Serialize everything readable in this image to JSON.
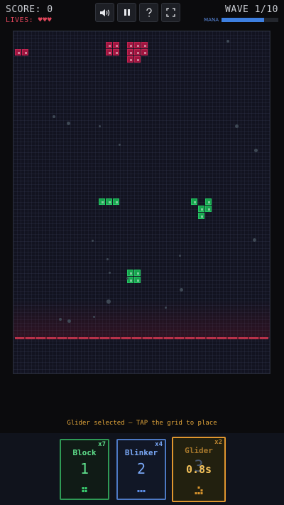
{
  "hud": {
    "score": "SCORE: 0",
    "lives": "LIVES: ♥♥♥",
    "wave": "WAVE 1/10",
    "mana_label": "MANA",
    "mana_fraction": 0.75
  },
  "toolbar": {
    "sound_icon": "speaker-icon",
    "pause_icon": "pause-icon",
    "help_icon": "question-icon",
    "fullscreen_icon": "fullscreen-icon"
  },
  "board": {
    "enemy_color": "#a0143f",
    "ally_color": "#16a34d",
    "defense_line_color": "#b8324a"
  },
  "hint": "Glider selected — TAP the grid to place",
  "cards": [
    {
      "name": "Block",
      "count": "x7",
      "cost": "1",
      "color": "#3ad371"
    },
    {
      "name": "Blinker",
      "count": "x4",
      "cost": "2",
      "color": "#5b8ce6"
    },
    {
      "name": "Glider",
      "count": "x2",
      "cost": "3",
      "cooldown": "0.8s",
      "color": "#e0962f",
      "selected": true
    }
  ]
}
